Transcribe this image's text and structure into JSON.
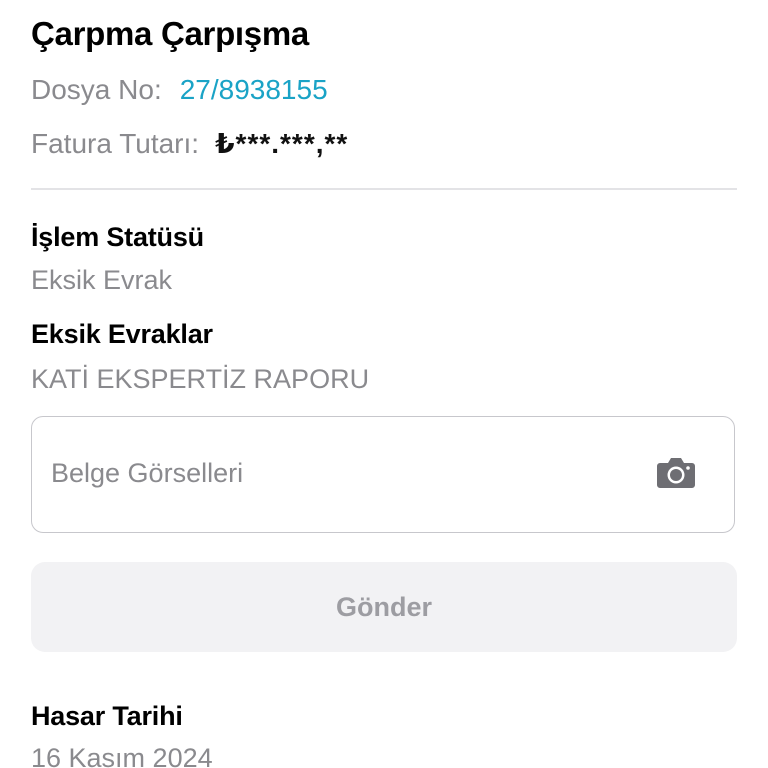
{
  "header": {
    "title": "Çarpma Çarpışma"
  },
  "file": {
    "number_label": "Dosya No:",
    "number_value": "27/8938155",
    "invoice_label": "Fatura Tutarı:",
    "invoice_value": "₺***.***,**"
  },
  "status": {
    "title": "İşlem Statüsü",
    "value": "Eksik Evrak"
  },
  "missing_docs": {
    "title": "Eksik Evraklar",
    "value": "KATİ EKSPERTİZ RAPORU"
  },
  "upload": {
    "placeholder": "Belge Görselleri",
    "icon": "camera-icon"
  },
  "actions": {
    "send_label": "Gönder",
    "send_enabled": false
  },
  "damage_date": {
    "title": "Hasar Tarihi",
    "value": "16 Kasım 2024"
  },
  "colors": {
    "accent": "#1aa3c6",
    "secondary_text": "#8a8a8e",
    "disabled_button_bg": "#f2f2f4",
    "disabled_button_text": "#9d9da2",
    "icon_gray": "#6e6e73"
  }
}
